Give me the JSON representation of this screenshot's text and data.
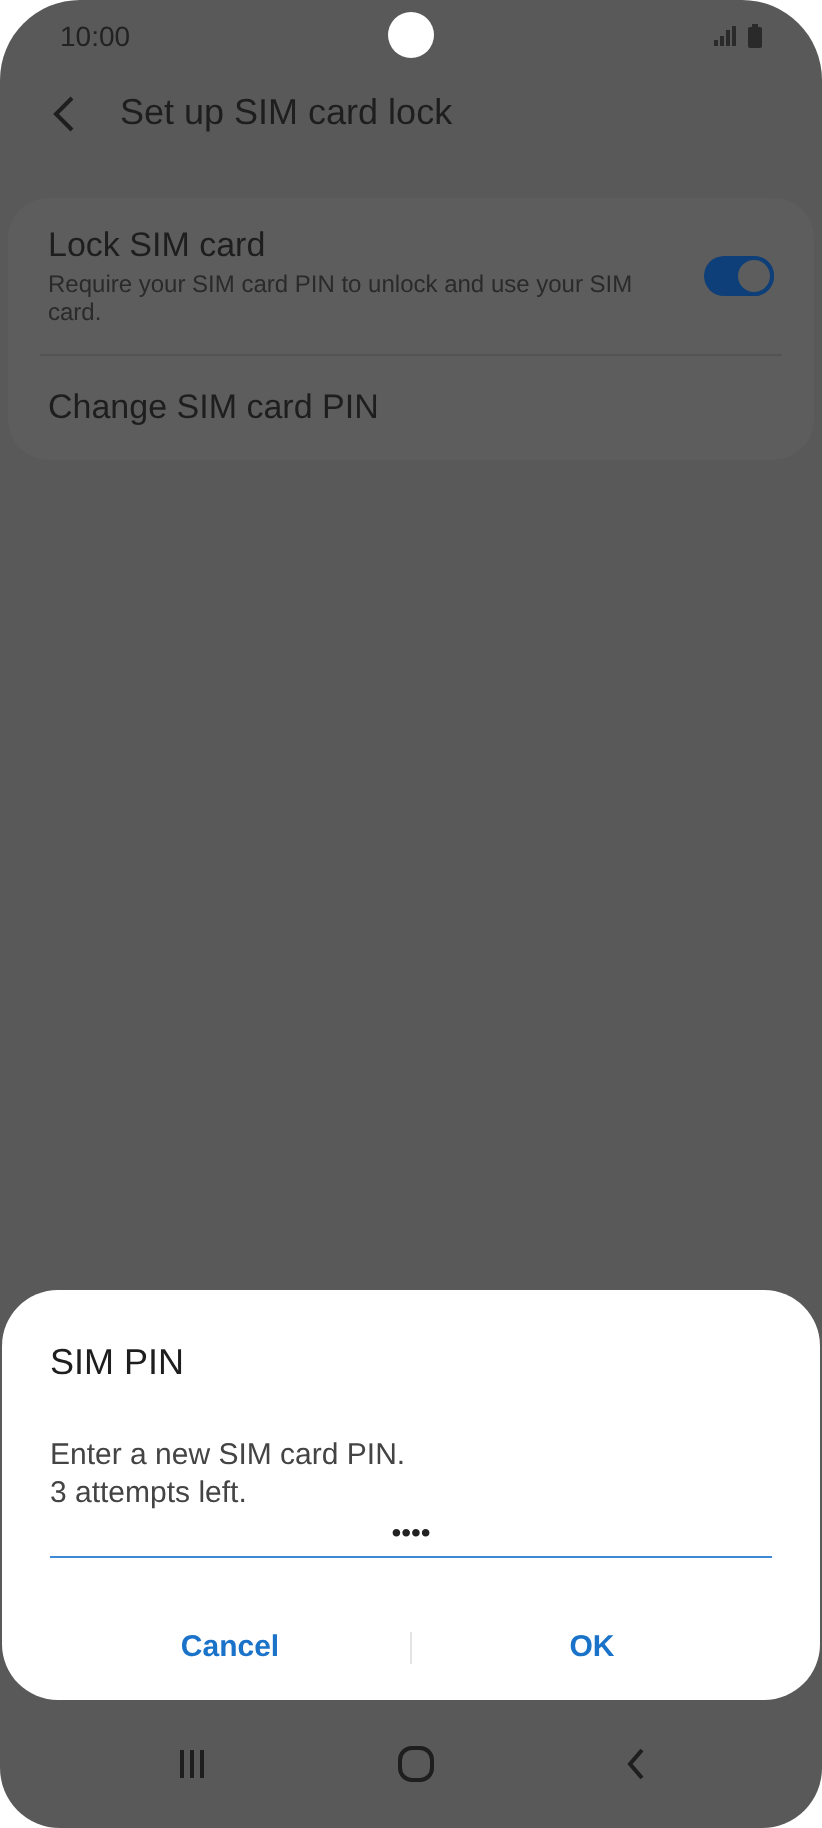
{
  "status_bar": {
    "time": "10:00"
  },
  "header": {
    "title": "Set up SIM card lock"
  },
  "settings": [
    {
      "kind": "toggle",
      "title": "Lock SIM card",
      "subtitle": "Require your SIM card PIN to unlock and use your SIM card.",
      "on": true
    },
    {
      "kind": "link",
      "title": "Change SIM card PIN"
    }
  ],
  "dialog": {
    "title": "SIM PIN",
    "message": "Enter a new SIM card PIN.\n3 attempts left.",
    "pin_value": "••••",
    "buttons": [
      "Cancel",
      "OK"
    ]
  }
}
